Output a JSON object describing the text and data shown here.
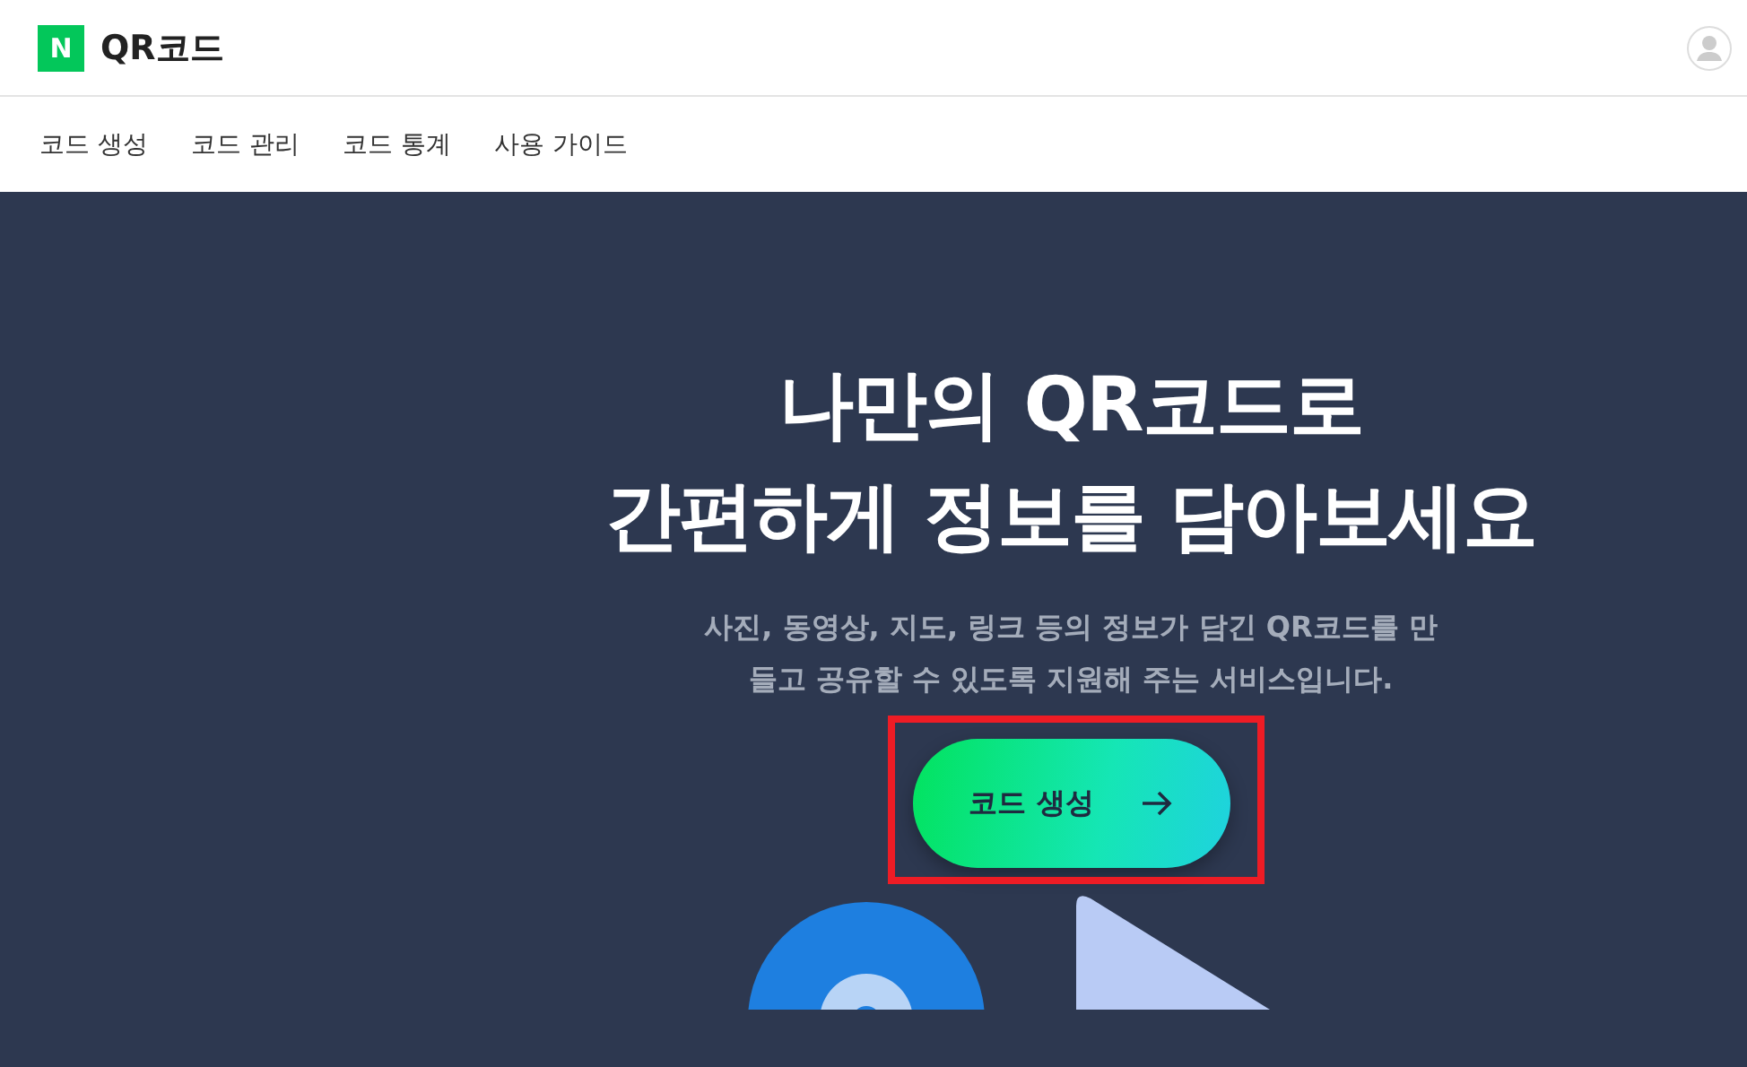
{
  "header": {
    "logo_letter": "N",
    "title": "QR코드"
  },
  "nav": [
    {
      "label": "코드 생성"
    },
    {
      "label": "코드 관리"
    },
    {
      "label": "코드 통계"
    },
    {
      "label": "사용 가이드"
    }
  ],
  "hero": {
    "title_lines": [
      "나만의 QR코드로",
      "간편하게 정보를 담아보세요"
    ],
    "description": "사진, 동영상, 지도, 링크 등의 정보가 담긴 QR코드를 만들고 공유할 수 있도록 지원해 주는 서비스입니다.",
    "button": {
      "label": "코드 생성",
      "highlighted": true
    }
  }
}
